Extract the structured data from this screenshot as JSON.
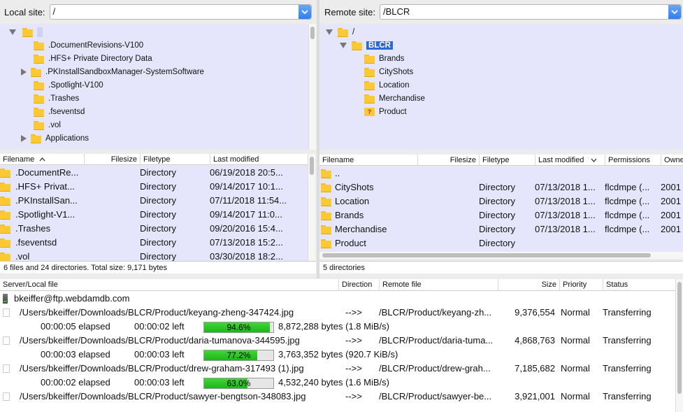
{
  "local": {
    "label": "Local site:",
    "path": "/",
    "tree": [
      {
        "label": "",
        "expanded": true,
        "root": true
      },
      {
        "label": ".DocumentRevisions-V100"
      },
      {
        "label": ".HFS+ Private Directory Data"
      },
      {
        "label": ".PKInstallSandboxManager-SystemSoftware",
        "collapsed": true
      },
      {
        "label": ".Spotlight-V100"
      },
      {
        "label": ".Trashes"
      },
      {
        "label": ".fseventsd"
      },
      {
        "label": ".vol"
      },
      {
        "label": "Applications",
        "collapsed": true
      }
    ],
    "columns": {
      "filename": "Filename",
      "filesize": "Filesize",
      "filetype": "Filetype",
      "modified": "Last modified"
    },
    "files": [
      {
        "name": ".DocumentRe...",
        "type": "Directory",
        "modified": "06/19/2018 20:5..."
      },
      {
        "name": ".HFS+ Privat...",
        "type": "Directory",
        "modified": "09/14/2017 10:1..."
      },
      {
        "name": ".PKInstallSan...",
        "type": "Directory",
        "modified": "07/11/2018 11:54..."
      },
      {
        "name": ".Spotlight-V1...",
        "type": "Directory",
        "modified": "09/14/2017 11:0..."
      },
      {
        "name": ".Trashes",
        "type": "Directory",
        "modified": "09/20/2016 15:4..."
      },
      {
        "name": ".fseventsd",
        "type": "Directory",
        "modified": "07/13/2018 15:2..."
      },
      {
        "name": ".vol",
        "type": "Directory",
        "modified": "03/30/2018 18:2..."
      }
    ],
    "status": "6 files and 24 directories. Total size: 9,171 bytes"
  },
  "remote": {
    "label": "Remote site:",
    "path": "/BLCR",
    "tree": [
      {
        "label": "/",
        "expanded": true
      },
      {
        "label": "BLCR",
        "expanded": true,
        "selected": true
      },
      {
        "label": "Brands"
      },
      {
        "label": "CityShots"
      },
      {
        "label": "Location"
      },
      {
        "label": "Merchandise"
      },
      {
        "label": "Product",
        "unknown": true
      }
    ],
    "columns": {
      "filename": "Filename",
      "filesize": "Filesize",
      "filetype": "Filetype",
      "modified": "Last modified",
      "permissions": "Permissions",
      "owner": "Owne"
    },
    "files": [
      {
        "name": "..",
        "type": "",
        "modified": "",
        "permissions": "",
        "owner": ""
      },
      {
        "name": "CityShots",
        "type": "Directory",
        "modified": "07/13/2018 1...",
        "permissions": "flcdmpe (...",
        "owner": "2001"
      },
      {
        "name": "Location",
        "type": "Directory",
        "modified": "07/13/2018 1...",
        "permissions": "flcdmpe (...",
        "owner": "2001"
      },
      {
        "name": "Brands",
        "type": "Directory",
        "modified": "07/13/2018 1...",
        "permissions": "flcdmpe (...",
        "owner": "2001"
      },
      {
        "name": "Merchandise",
        "type": "Directory",
        "modified": "07/13/2018 1...",
        "permissions": "flcdmpe (...",
        "owner": "2001"
      },
      {
        "name": "Product",
        "type": "Directory",
        "modified": "",
        "permissions": "",
        "owner": ""
      }
    ],
    "status": "5 directories"
  },
  "queue": {
    "columns": {
      "local": "Server/Local file",
      "direction": "Direction",
      "remote": "Remote file",
      "size": "Size",
      "priority": "Priority",
      "status": "Status"
    },
    "server": "bkeiffer@ftp.webdamdb.com",
    "transfers": [
      {
        "local": "/Users/bkeiffer/Downloads/BLCR/Product/keyang-zheng-347424.jpg",
        "direction": "-->>",
        "remote": "/BLCR/Product/keyang-zh...",
        "size": "9,376,554",
        "priority": "Normal",
        "status": "Transferring",
        "elapsed": "00:00:05 elapsed",
        "left": "00:00:02 left",
        "progress": 0.946,
        "progress_label": "94.6%",
        "bytes": "8,872,288 bytes (1.8 MiB/s)"
      },
      {
        "local": "/Users/bkeiffer/Downloads/BLCR/Product/daria-tumanova-344595.jpg",
        "direction": "-->>",
        "remote": "/BLCR/Product/daria-tuma...",
        "size": "4,868,763",
        "priority": "Normal",
        "status": "Transferring",
        "elapsed": "00:00:03 elapsed",
        "left": "00:00:03 left",
        "progress": 0.772,
        "progress_label": "77.2%",
        "bytes": "3,763,352 bytes (920.7 KiB/s)"
      },
      {
        "local": "/Users/bkeiffer/Downloads/BLCR/Product/drew-graham-317493 (1).jpg",
        "direction": "-->>",
        "remote": "/BLCR/Product/drew-grah...",
        "size": "7,185,682",
        "priority": "Normal",
        "status": "Transferring",
        "elapsed": "00:00:02 elapsed",
        "left": "00:00:03 left",
        "progress": 0.63,
        "progress_label": "63.0%",
        "bytes": "4,532,240 bytes (1.6 MiB/s)"
      },
      {
        "local": "/Users/bkeiffer/Downloads/BLCR/Product/sawyer-bengtson-348083.jpg",
        "direction": "-->>",
        "remote": "/BLCR/Product/sawyer-be...",
        "size": "3,921,001",
        "priority": "Normal",
        "status": "Transferring"
      }
    ]
  }
}
